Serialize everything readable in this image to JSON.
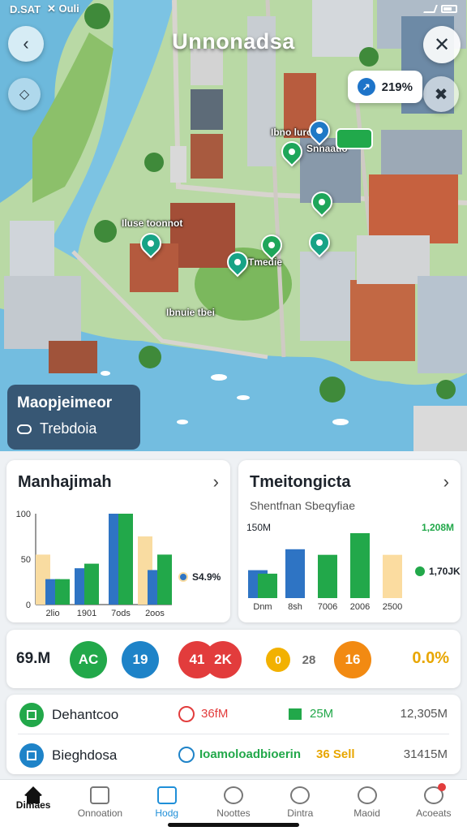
{
  "status_bar": {
    "time": "D.SAT",
    "carrier": "✕ Ouli"
  },
  "map": {
    "title": "Unnonadsa",
    "chip_value": "219%",
    "labels": [
      "Ibno luroen",
      "Snnaatio",
      "Iluse toonnot",
      "Tmedie",
      "Ibnuie tbei"
    ],
    "info_card": {
      "title": "Maopjeimeor",
      "subtitle": "Trebdoia"
    }
  },
  "card_left": {
    "title": "Manhajimah",
    "legend_value": "S4.9%",
    "y_ticks": [
      "100",
      "50",
      "0"
    ],
    "chart_data": {
      "type": "bar",
      "categories": [
        "2lio",
        "1901",
        "7ods",
        "2oos"
      ],
      "ylim": [
        0,
        100
      ],
      "series": [
        {
          "color": "#f9dca1",
          "values": [
            55,
            0,
            0,
            75
          ]
        },
        {
          "color": "#2e74c4",
          "values": [
            28,
            40,
            100,
            38
          ]
        },
        {
          "color": "#22a84a",
          "values": [
            28,
            45,
            100,
            55
          ]
        }
      ]
    }
  },
  "card_right": {
    "title": "Tmeitongicta",
    "subtitle": "Shentfnan Sbeqyfiae",
    "y_top_label": "150M",
    "right_top_value": "1,208M",
    "legend_value": "1,70JK",
    "chart_data": {
      "type": "bar",
      "categories": [
        "Dnm",
        "8sh",
        "7006",
        "2006",
        "2500"
      ],
      "ylim": [
        0,
        100
      ],
      "series": [
        {
          "name": "",
          "color": "#2e74c4",
          "values": [
            40,
            70,
            0,
            0,
            0
          ]
        },
        {
          "name": "",
          "color": "#22a84a",
          "values": [
            35,
            0,
            62,
            93,
            0
          ]
        },
        {
          "name": "",
          "color": "#fbdca0",
          "values": [
            0,
            0,
            0,
            0,
            62
          ]
        }
      ]
    }
  },
  "kpis": {
    "first": "69.M",
    "items": [
      {
        "label": "AC",
        "color": "#22a84a"
      },
      {
        "label": "19",
        "color": "#1e83c8"
      },
      {
        "label": "41",
        "color": "#e23c3c"
      },
      {
        "label": "2K",
        "color": "#e23c3c"
      },
      {
        "label": "0",
        "color": "#f2b100"
      },
      {
        "label": "28",
        "color": "ghost"
      },
      {
        "label": "16",
        "color": "#f28a12"
      }
    ],
    "last": "0.0%"
  },
  "list": [
    {
      "title": "Dehantcoo",
      "icon_color": "#22a84a",
      "mid_icon_color": "#e23c3c",
      "mid_value": "36fM",
      "green_value": "25M",
      "right": "12,305M"
    },
    {
      "title": "Bieghdosa",
      "icon_color": "#1e83c8",
      "mid_icon_color": "#1e83c8",
      "mid_value": "Ioamoloadbioerin",
      "green_value": "36 Sell",
      "right": "31415M"
    }
  ],
  "tabs": [
    {
      "label": "Dimaes"
    },
    {
      "label": "Onnoation"
    },
    {
      "label": "Hodg"
    },
    {
      "label": "Noottes"
    },
    {
      "label": "Dintra"
    },
    {
      "label": "Maoid"
    },
    {
      "label": "Acoeats"
    }
  ]
}
